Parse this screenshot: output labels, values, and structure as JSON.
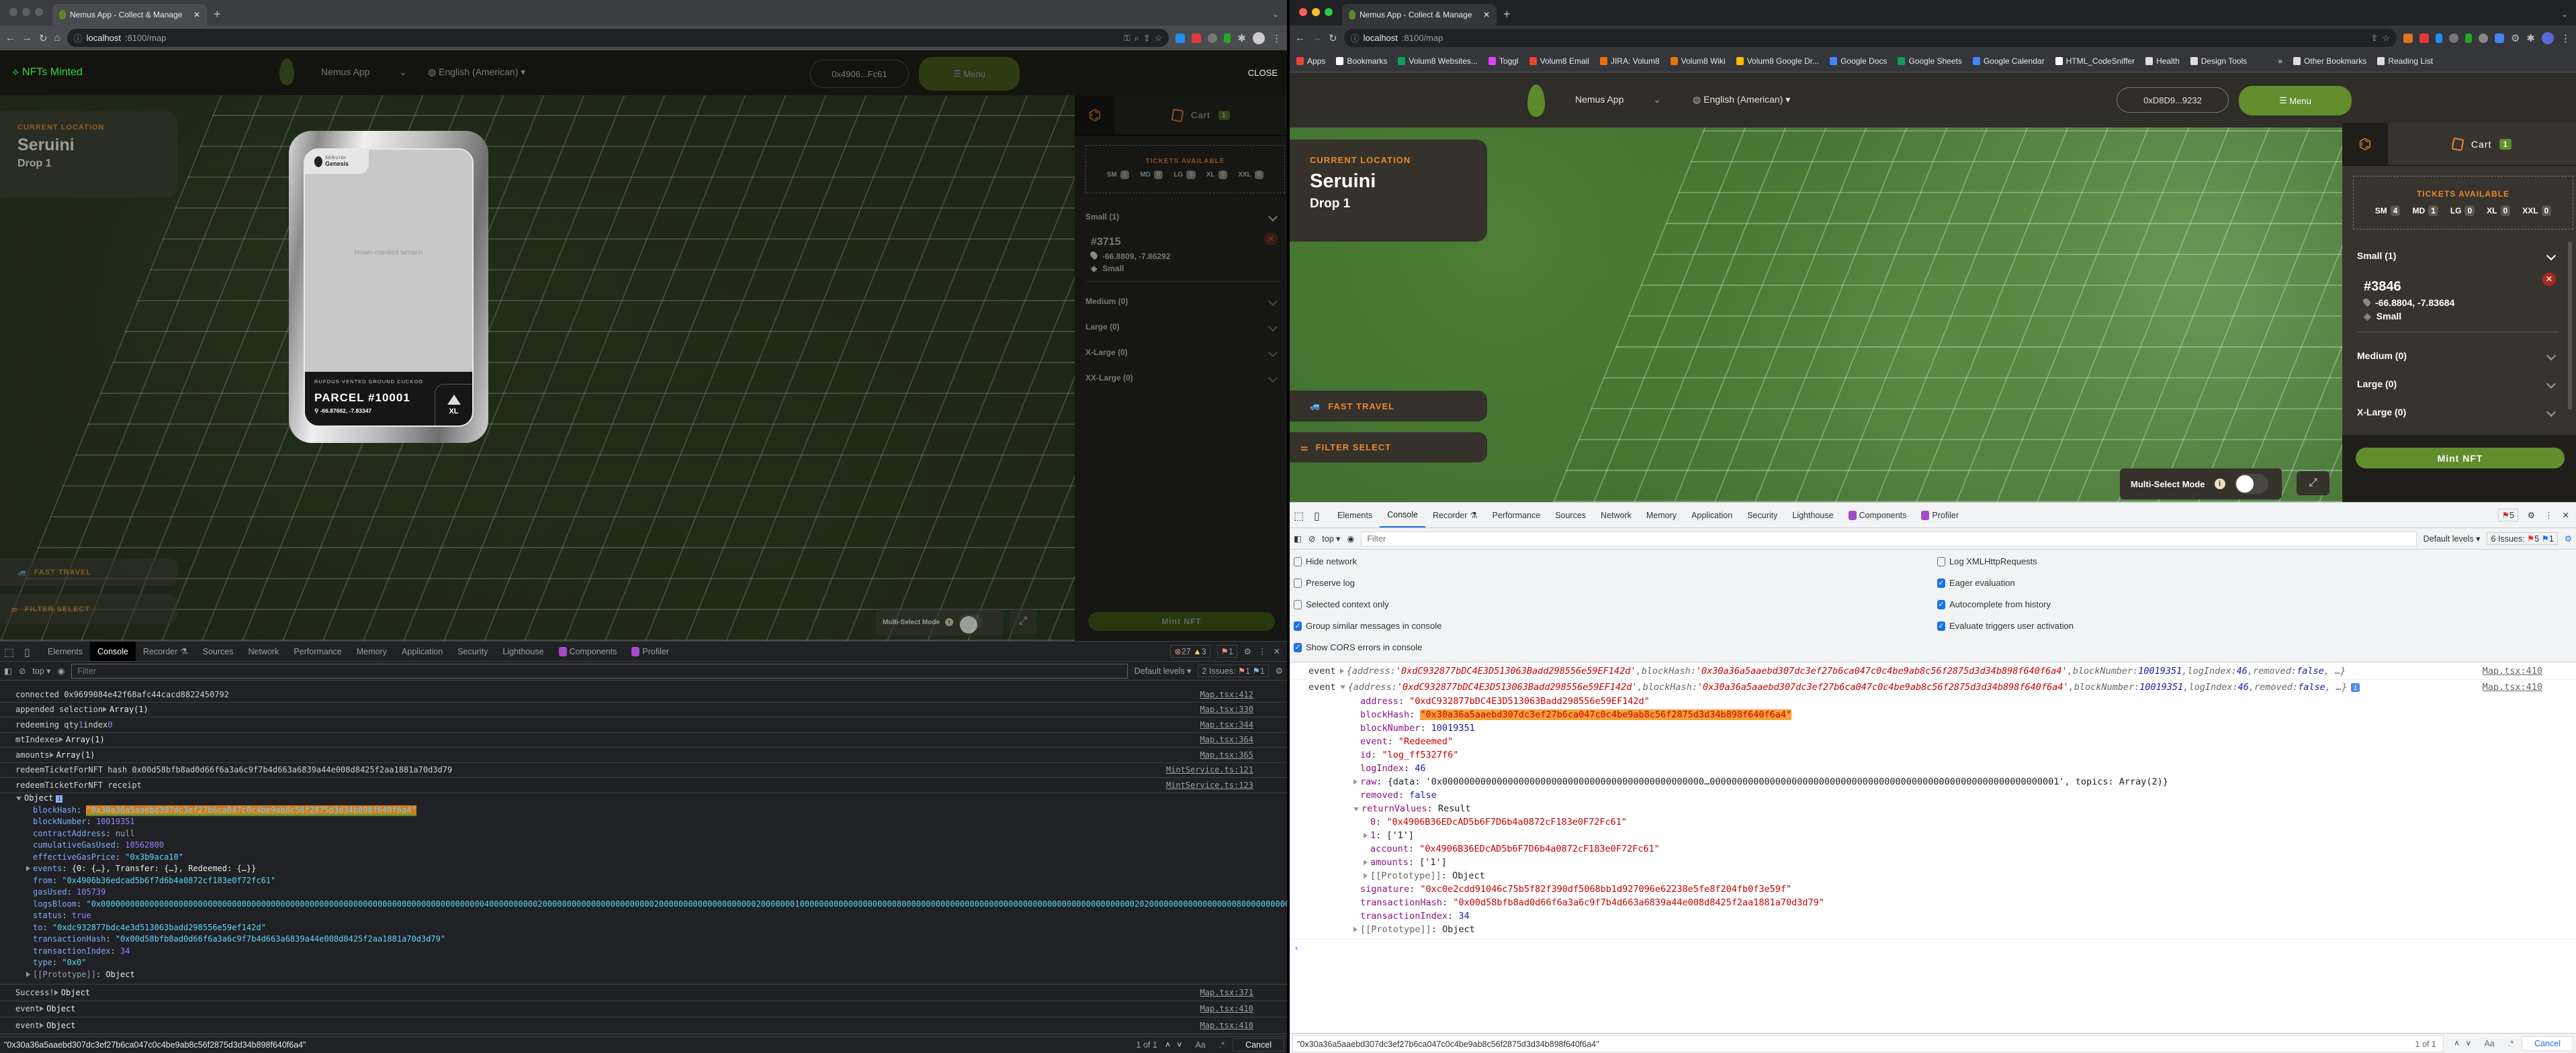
{
  "left_window": {
    "tab_title": "Nemus App - Collect & Manage",
    "url_host": "localhost",
    "url_path": ":8100/map",
    "app": {
      "overlay_title": "NFTs Minted",
      "close": "CLOSE",
      "brand": "Nemus App",
      "language": "English (American)",
      "wallet": "0x4906...Fc61",
      "menu": "Menu",
      "location": {
        "label": "CURRENT LOCATION",
        "name": "Seruini",
        "drop": "Drop 1"
      },
      "fast_travel": "FAST TRAVEL",
      "filter_select": "FILTER SELECT",
      "multi_select": "Multi-Select Mode",
      "multi_select_on": false,
      "mint": "Mint NFT",
      "cart": {
        "label": "Cart",
        "count": "1"
      },
      "tickets": {
        "title": "TICKETS AVAILABLE",
        "items": [
          {
            "size": "SM",
            "count": "1"
          },
          {
            "size": "MD",
            "count": "0"
          },
          {
            "size": "LG",
            "count": "0"
          },
          {
            "size": "XL",
            "count": "0"
          },
          {
            "size": "XXL",
            "count": "0"
          }
        ]
      },
      "groups": [
        {
          "label": "Small (1)"
        },
        {
          "label": "Medium (0)"
        },
        {
          "label": "Large (0)"
        },
        {
          "label": "X-Large (0)"
        },
        {
          "label": "XX-Large (0)"
        }
      ],
      "selected": {
        "id": "#3715",
        "coords": "-66.8809, -7.86292",
        "size": "Small"
      },
      "nft_card": {
        "collection": "SERUINI",
        "series": "Genesis",
        "image_alt": "brown-mantled tamarin",
        "species": "RUFOUS-VENTED GROUND CUCKOO",
        "parcel": "PARCEL #10001",
        "coords": "-66.87662, -7.83347",
        "size": "XL"
      }
    },
    "devtools": {
      "tabs": [
        "Elements",
        "Console",
        "Recorder",
        "Sources",
        "Network",
        "Performance",
        "Memory",
        "Application",
        "Security",
        "Lighthouse",
        "Components",
        "Profiler"
      ],
      "active_tab": "Console",
      "errors": "27",
      "warnings": "3",
      "issue_badge": "1",
      "context": "top",
      "filter_placeholder": "Filter",
      "levels": "Default levels",
      "issues_label": "2 Issues:",
      "issues_err": "1",
      "issues_info": "1",
      "logs": [
        {
          "parts": [
            {
              "t": "connected 0x9699084e42f68afc44cacd8822450792",
              "c": "p"
            }
          ],
          "src": "Map.tsx:412"
        },
        {
          "parts": [
            {
              "t": "appended selection ",
              "c": "p"
            },
            {
              "t": "Array(1)",
              "c": "o",
              "tog": true
            }
          ],
          "src": "Map.tsx:330"
        },
        {
          "parts": [
            {
              "t": "redeeming qty ",
              "c": "p"
            },
            {
              "t": "1",
              "c": "n"
            },
            {
              "t": " index ",
              "c": "p"
            },
            {
              "t": "0",
              "c": "n"
            }
          ],
          "src": "Map.tsx:344"
        },
        {
          "parts": [
            {
              "t": "mtIndexes ",
              "c": "p"
            },
            {
              "t": "Array(1)",
              "c": "o",
              "tog": true
            }
          ],
          "src": "Map.tsx:364"
        },
        {
          "parts": [
            {
              "t": "amounts ",
              "c": "p"
            },
            {
              "t": "Array(1)",
              "c": "o",
              "tog": true
            }
          ],
          "src": "Map.tsx:365"
        },
        {
          "parts": [
            {
              "t": "redeemTicketForNFT hash 0x00d58bfb8ad0d66f6a3a6c9f7b4d663a6839a44e008d8425f2aa1881a70d3d79",
              "c": "p"
            }
          ],
          "src": "MintService.ts:121"
        },
        {
          "parts": [
            {
              "t": "redeemTicketForNFT receipt",
              "c": "p"
            }
          ],
          "src": "MintService.ts:123"
        }
      ],
      "receipt_object": "Object",
      "receipt_props": [
        {
          "k": "blockHash",
          "v": "\"0x30a36a5aaebd307dc3ef27b6ca047c0c4be9ab8c56f2875d3d34b898f640f6a4\"",
          "c": "s hl"
        },
        {
          "k": "blockNumber",
          "v": "10019351",
          "c": "n"
        },
        {
          "k": "contractAddress",
          "v": "null",
          "c": "nl"
        },
        {
          "k": "cumulativeGasUsed",
          "v": "10562800",
          "c": "n"
        },
        {
          "k": "effectiveGasPrice",
          "v": "\"0x3b9aca10\"",
          "c": "s"
        },
        {
          "k": "events",
          "v": "{0: {…}, Transfer: {…}, Redeemed: {…}}",
          "c": "o",
          "tog": true
        },
        {
          "k": "from",
          "v": "\"0x4906b36edcad5b6f7d6b4a0872cf183e0f72fc61\"",
          "c": "s"
        },
        {
          "k": "gasUsed",
          "v": "105739",
          "c": "n"
        },
        {
          "k": "logsBloom",
          "v": "\"0x000000000000000000000000000000000000000000000000000000000000000000000000000000040000000000200000000000000000000000200000000000000000000200000001000000000000000000008000000000000000000000000000000000000000000000000202000000000000000000800000000000000…",
          "c": "s"
        },
        {
          "k": "status",
          "v": "true",
          "c": "b"
        },
        {
          "k": "to",
          "v": "\"0xdc932877bdc4e3d513063badd298556e59ef142d\"",
          "c": "s"
        },
        {
          "k": "transactionHash",
          "v": "\"0x00d58bfb8ad0d66f6a3a6c9f7b4d663a6839a44e008d8425f2aa1881a70d3d79\"",
          "c": "s"
        },
        {
          "k": "transactionIndex",
          "v": "34",
          "c": "n"
        },
        {
          "k": "type",
          "v": "\"0x0\"",
          "c": "s"
        },
        {
          "k": "[[Prototype]]",
          "v": "Object",
          "c": "o",
          "kc": "g",
          "tog": true
        }
      ],
      "after_logs": [
        {
          "parts": [
            {
              "t": "Success! ",
              "c": "p"
            },
            {
              "t": "Object",
              "c": "o",
              "tog": true
            }
          ],
          "src": "Map.tsx:371"
        },
        {
          "parts": [
            {
              "t": "event ",
              "c": "p"
            },
            {
              "t": "Object",
              "c": "o",
              "tog": true
            }
          ],
          "src": "Map.tsx:410"
        },
        {
          "parts": [
            {
              "t": "event ",
              "c": "p"
            },
            {
              "t": "Object",
              "c": "o",
              "tog": true
            }
          ],
          "src": "Map.tsx:410"
        }
      ],
      "search": {
        "value": "\"0x30a36a5aaebd307dc3ef27b6ca047c0c4be9ab8c56f2875d3d34b898f640f6a4\"",
        "count": "1 of 1",
        "case": "Aa",
        "regex": ".*",
        "cancel": "Cancel"
      }
    }
  },
  "right_window": {
    "tab_title": "Nemus App - Collect & Manage",
    "url_host": "localhost",
    "url_path": ":8100/map",
    "bookmarks": [
      "Apps",
      "Bookmarks",
      "Volum8 Websites...",
      "Toggl",
      "Volum8 Email",
      "JIRA: Volum8",
      "Volum8 Wiki",
      "Volum8 Google Dr...",
      "Google Docs",
      "Google Sheets",
      "Google Calendar",
      "HTML_CodeSniffer",
      "Health",
      "Design Tools",
      "»",
      "Other Bookmarks",
      "Reading List"
    ],
    "app": {
      "brand": "Nemus App",
      "language": "English (American)",
      "wallet": "0xD8D9...9232",
      "menu": "Menu",
      "location": {
        "label": "CURRENT LOCATION",
        "name": "Seruini",
        "drop": "Drop 1"
      },
      "fast_travel": "FAST TRAVEL",
      "filter_select": "FILTER SELECT",
      "multi_select": "Multi-Select Mode",
      "multi_select_on": false,
      "mint": "Mint NFT",
      "cart": {
        "label": "Cart",
        "count": "1"
      },
      "tickets": {
        "title": "TICKETS AVAILABLE",
        "items": [
          {
            "size": "SM",
            "count": "4"
          },
          {
            "size": "MD",
            "count": "1"
          },
          {
            "size": "LG",
            "count": "0"
          },
          {
            "size": "XL",
            "count": "0"
          },
          {
            "size": "XXL",
            "count": "0"
          }
        ]
      },
      "groups": [
        {
          "label": "Small (1)"
        },
        {
          "label": "Medium (0)"
        },
        {
          "label": "Large (0)"
        },
        {
          "label": "X-Large (0)"
        }
      ],
      "selected": {
        "id": "#3846",
        "coords": "-66.8804, -7.83684",
        "size": "Small"
      }
    },
    "devtools": {
      "tabs": [
        "Elements",
        "Console",
        "Recorder",
        "Performance",
        "Sources",
        "Network",
        "Memory",
        "Application",
        "Security",
        "Lighthouse",
        "Components",
        "Profiler"
      ],
      "active_tab": "Console",
      "issue_badge": "5",
      "context": "top",
      "filter_placeholder": "Filter",
      "levels": "Default levels",
      "issues_label": "6 Issues:",
      "issues_err": "5",
      "issues_info": "1",
      "settings": [
        {
          "label": "Hide network",
          "checked": false
        },
        {
          "label": "Preserve log",
          "checked": false
        },
        {
          "label": "Selected context only",
          "checked": false
        },
        {
          "label": "Group similar messages in console",
          "checked": true
        },
        {
          "label": "Show CORS errors in console",
          "checked": true
        },
        {
          "label": "Log XMLHttpRequests",
          "checked": false
        },
        {
          "label": "Eager evaluation",
          "checked": true
        },
        {
          "label": "Autocomplete from history",
          "checked": true
        },
        {
          "label": "Evaluate triggers user activation",
          "checked": true
        }
      ],
      "event_summary": [
        {
          "t": "{",
          "c": "ki"
        },
        {
          "t": "address",
          "c": "ki"
        },
        {
          "t": ": ",
          "c": "ki"
        },
        {
          "t": "'0xdC932877bDC4E3D513063Badd298556e59EF142d'",
          "c": "si"
        },
        {
          "t": ", ",
          "c": "ki"
        },
        {
          "t": "blockHash",
          "c": "ki"
        },
        {
          "t": ": ",
          "c": "ki"
        },
        {
          "t": "'0x30a36a5aaebd307dc3ef27b6ca047c0c4be9ab8c56f2875d3d34b898f640f6a4'",
          "c": "si"
        },
        {
          "t": ", ",
          "c": "ki"
        },
        {
          "t": "blockNumber",
          "c": "ki"
        },
        {
          "t": ": ",
          "c": "ki"
        },
        {
          "t": "10019351",
          "c": "ni"
        },
        {
          "t": ", ",
          "c": "ki"
        },
        {
          "t": "logIndex",
          "c": "ki"
        },
        {
          "t": ": ",
          "c": "ki"
        },
        {
          "t": "46",
          "c": "ni"
        },
        {
          "t": ", ",
          "c": "ki"
        },
        {
          "t": "removed",
          "c": "ki"
        },
        {
          "t": ": ",
          "c": "ki"
        },
        {
          "t": "false",
          "c": "ni"
        },
        {
          "t": ", …}",
          "c": "ki"
        }
      ],
      "event_label": "event",
      "event_src": "Map.tsx:410",
      "event_props": [
        {
          "k": "address",
          "v": "\"0xdC932877bDC4E3D513063Badd298556e59EF142d\"",
          "c": "s",
          "lvl": 0
        },
        {
          "k": "blockHash",
          "v": "\"0x30a36a5aaebd307dc3ef27b6ca047c0c4be9ab8c56f2875d3d34b898f640f6a4\"",
          "c": "s hl",
          "lvl": 0
        },
        {
          "k": "blockNumber",
          "v": "10019351",
          "c": "n",
          "lvl": 0
        },
        {
          "k": "event",
          "v": "\"Redeemed\"",
          "c": "s",
          "lvl": 0
        },
        {
          "k": "id",
          "v": "\"log_ff5327f6\"",
          "c": "s",
          "lvl": 0
        },
        {
          "k": "logIndex",
          "v": "46",
          "c": "n",
          "lvl": 0
        },
        {
          "k": "raw",
          "v": "{data: '0x000000000000000000000000000000000000000000000000…0000000000000000000000000000000000000000000000000000000000000001', topics: Array(2)}",
          "c": "o",
          "lvl": 0,
          "tog": true
        },
        {
          "k": "removed",
          "v": "false",
          "c": "b",
          "lvl": 0
        },
        {
          "k": "returnValues",
          "v": "Result",
          "c": "o",
          "lvl": 0,
          "tog": "open"
        },
        {
          "k": "0",
          "v": "\"0x4906B36EDcAD5b6F7D6b4a0872cF183e0F72Fc61\"",
          "c": "s",
          "lvl": 1
        },
        {
          "k": "1",
          "v": "['1']",
          "c": "o",
          "lvl": 1,
          "tog": true
        },
        {
          "k": "account",
          "v": "\"0x4906B36EDcAD5b6F7D6b4a0872cF183e0F72Fc61\"",
          "c": "s",
          "lvl": 1
        },
        {
          "k": "amounts",
          "v": "['1']",
          "c": "o",
          "lvl": 1,
          "tog": true
        },
        {
          "k": "[[Prototype]]",
          "v": "Object",
          "c": "o",
          "kc": "g",
          "lvl": 1,
          "tog": true
        },
        {
          "k": "signature",
          "v": "\"0xc0e2cdd91046c75b5f82f390df5068bb1d927096e62238e5fe8f204fb0f3e59f\"",
          "c": "s",
          "lvl": 0
        },
        {
          "k": "transactionHash",
          "v": "\"0x00d58bfb8ad0d66f6a3a6c9f7b4d663a6839a44e008d8425f2aa1881a70d3d79\"",
          "c": "s",
          "lvl": 0
        },
        {
          "k": "transactionIndex",
          "v": "34",
          "c": "n",
          "lvl": 0
        },
        {
          "k": "[[Prototype]]",
          "v": "Object",
          "c": "o",
          "kc": "g",
          "lvl": 0,
          "tog": true
        }
      ],
      "prompt": "›",
      "search": {
        "value": "\"0x30a36a5aaebd307dc3ef27b6ca047c0c4be9ab8c56f2875d3d34b898f640f6a4\"",
        "count": "1 of 1",
        "case": "Aa",
        "regex": ".*",
        "cancel": "Cancel"
      }
    }
  },
  "colors": {
    "accent_orange": "#e98a2c",
    "brand_green": "#618d2c",
    "panel_brown": "#35312b",
    "highlight": "#f8a13a"
  }
}
